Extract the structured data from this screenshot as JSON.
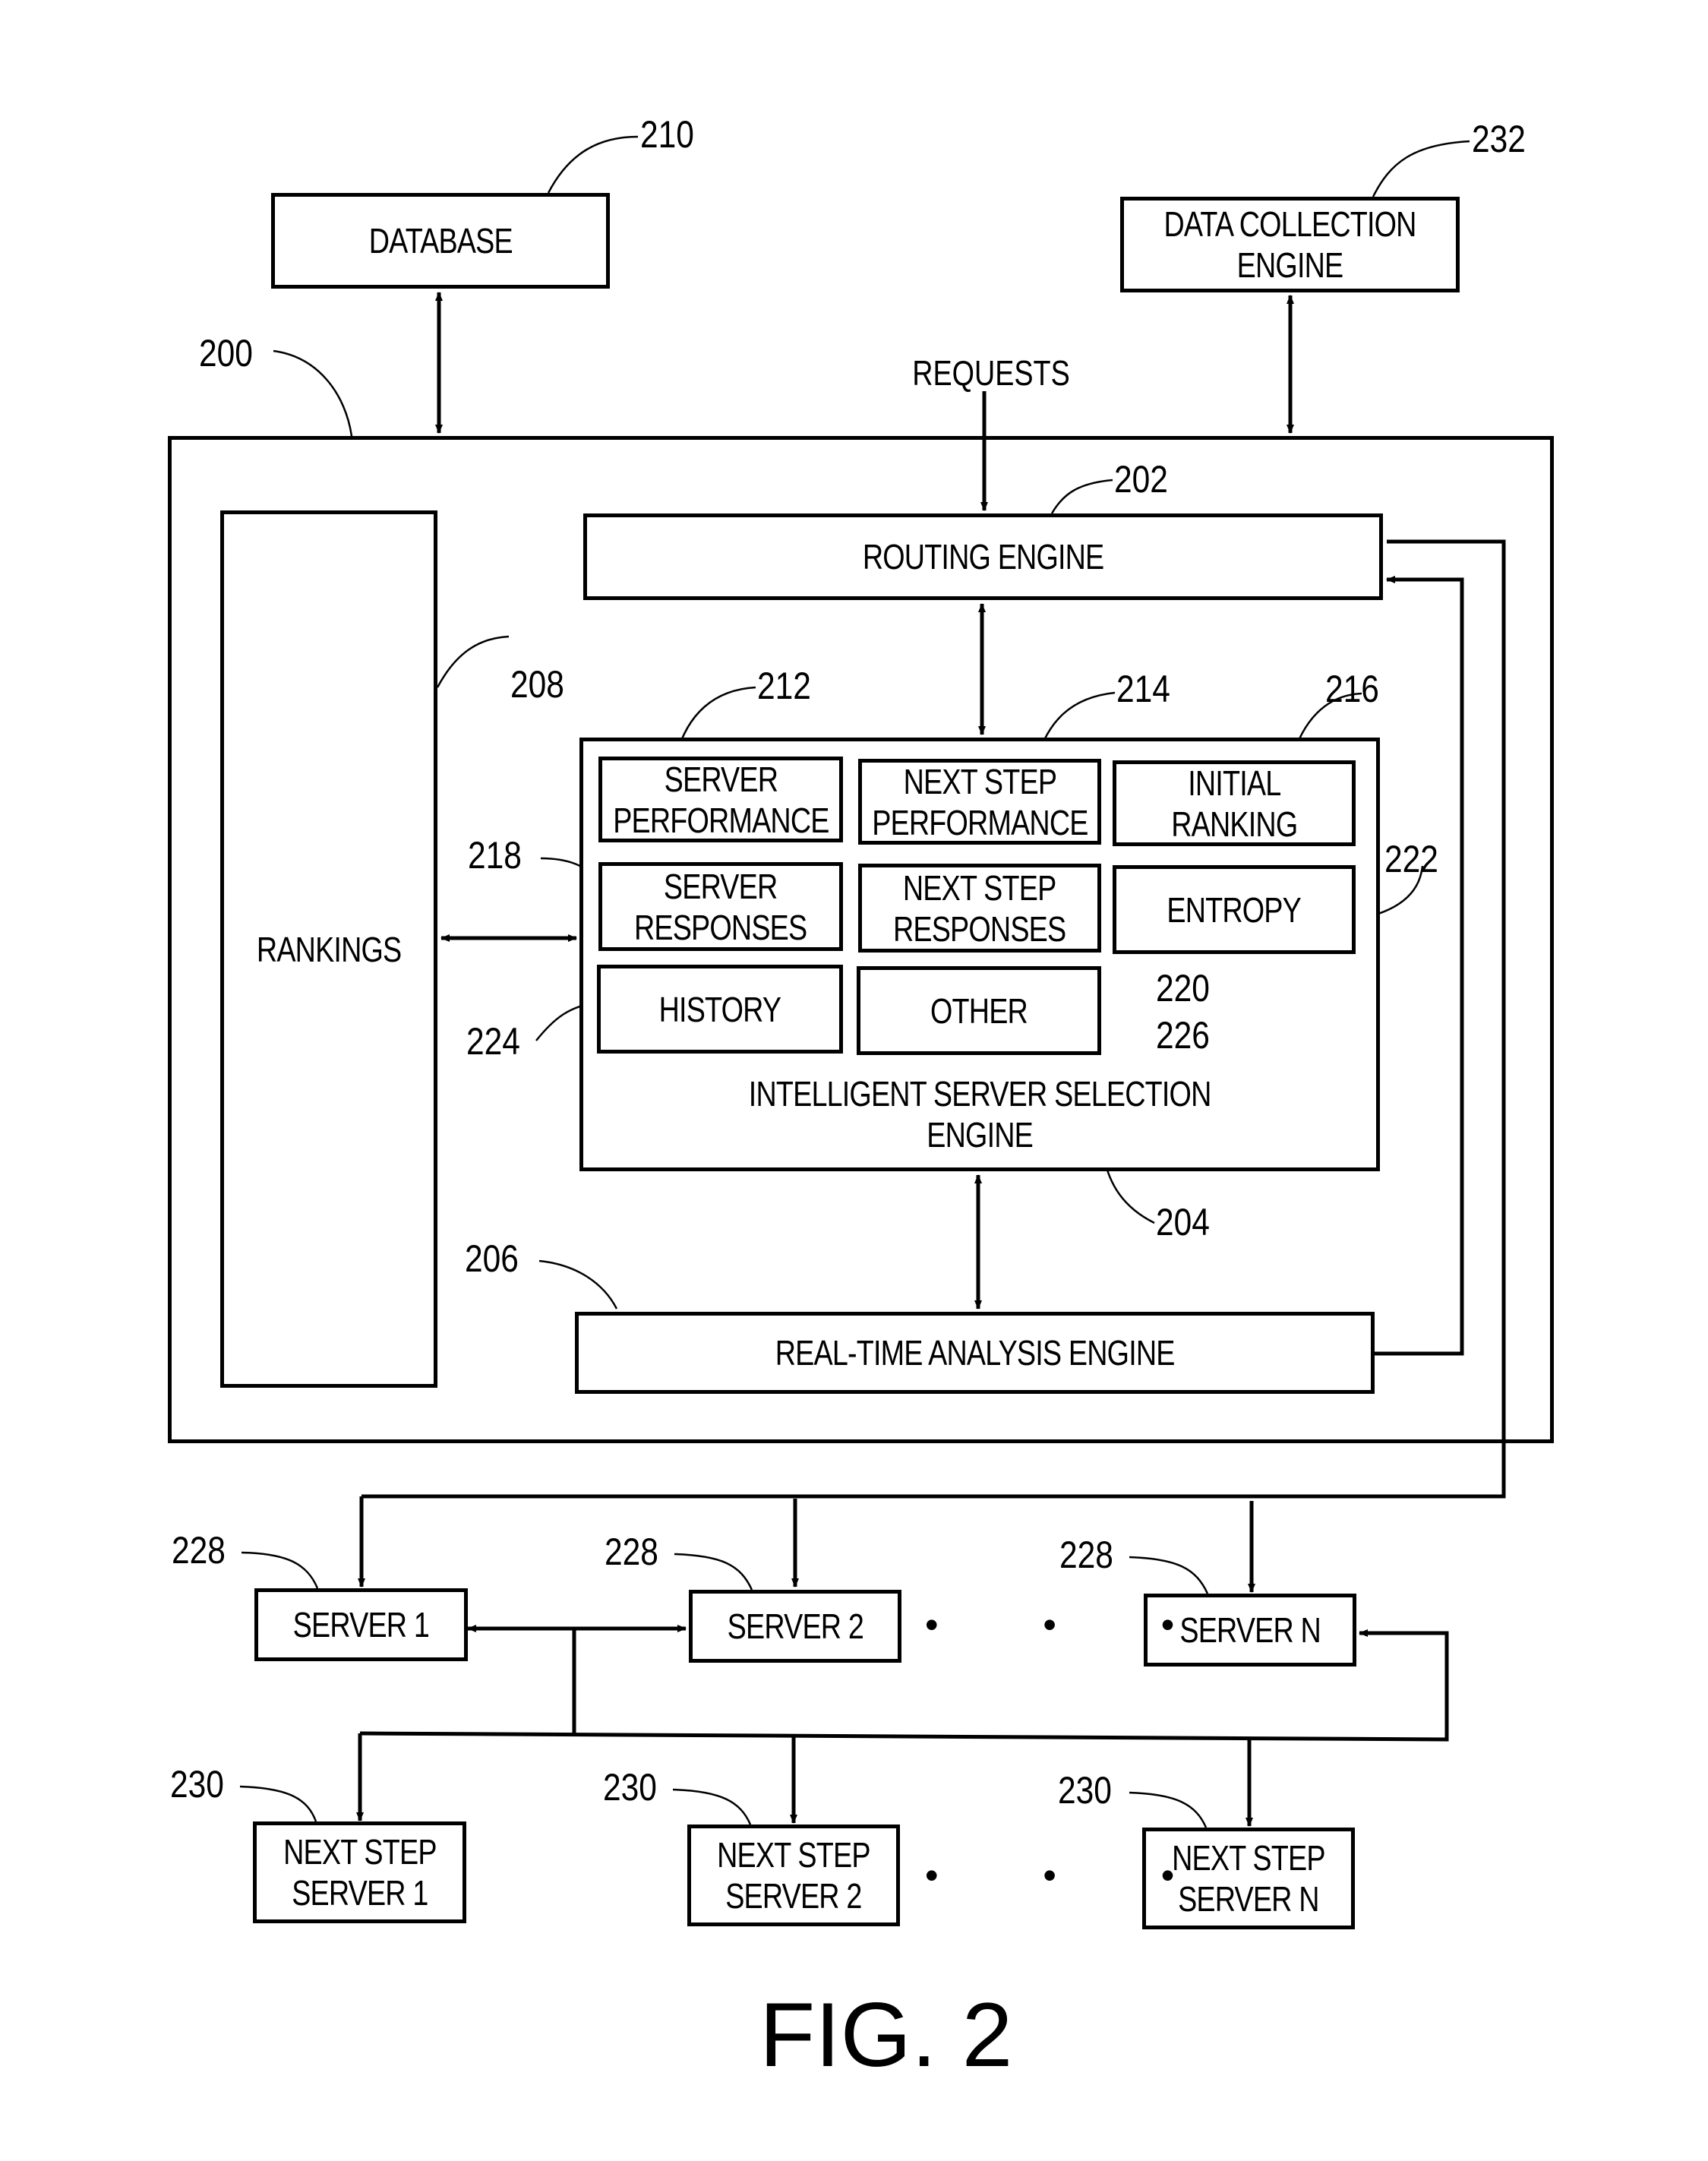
{
  "figure": {
    "title": "FIG. 2",
    "system_ref": "200",
    "input_label": "REQUESTS"
  },
  "external": {
    "database": {
      "label": "DATABASE",
      "ref": "210"
    },
    "data_collection": {
      "label": "DATA COLLECTION\nENGINE",
      "ref": "232"
    }
  },
  "system": {
    "rankings": {
      "label": "RANKINGS",
      "ref": "208"
    },
    "routing_engine": {
      "label": "ROUTING ENGINE",
      "ref": "202"
    },
    "iss_engine": {
      "label": "INTELLIGENT SERVER SELECTION\nENGINE",
      "ref": "204",
      "modules": [
        {
          "label": "SERVER\nPERFORMANCE",
          "ref": "212"
        },
        {
          "label": "NEXT STEP\nPERFORMANCE",
          "ref": "214"
        },
        {
          "label": "INITIAL\nRANKING",
          "ref": "216"
        },
        {
          "label": "SERVER\nRESPONSES",
          "ref": "218"
        },
        {
          "label": "NEXT STEP\nRESPONSES",
          "ref": "220"
        },
        {
          "label": "ENTROPY",
          "ref": "222"
        },
        {
          "label": "HISTORY",
          "ref": "224"
        },
        {
          "label": "OTHER",
          "ref": "226"
        }
      ]
    },
    "real_time_engine": {
      "label": "REAL-TIME ANALYSIS ENGINE",
      "ref": "206"
    }
  },
  "servers": {
    "ref": "228",
    "items": [
      {
        "label": "SERVER 1"
      },
      {
        "label": "SERVER 2"
      },
      {
        "label": "SERVER N"
      }
    ],
    "ellipsis": "• • •"
  },
  "next_step_servers": {
    "ref": "230",
    "items": [
      {
        "label": "NEXT STEP\nSERVER 1"
      },
      {
        "label": "NEXT STEP\nSERVER 2"
      },
      {
        "label": "NEXT STEP\nSERVER N"
      }
    ],
    "ellipsis": "• • •"
  }
}
